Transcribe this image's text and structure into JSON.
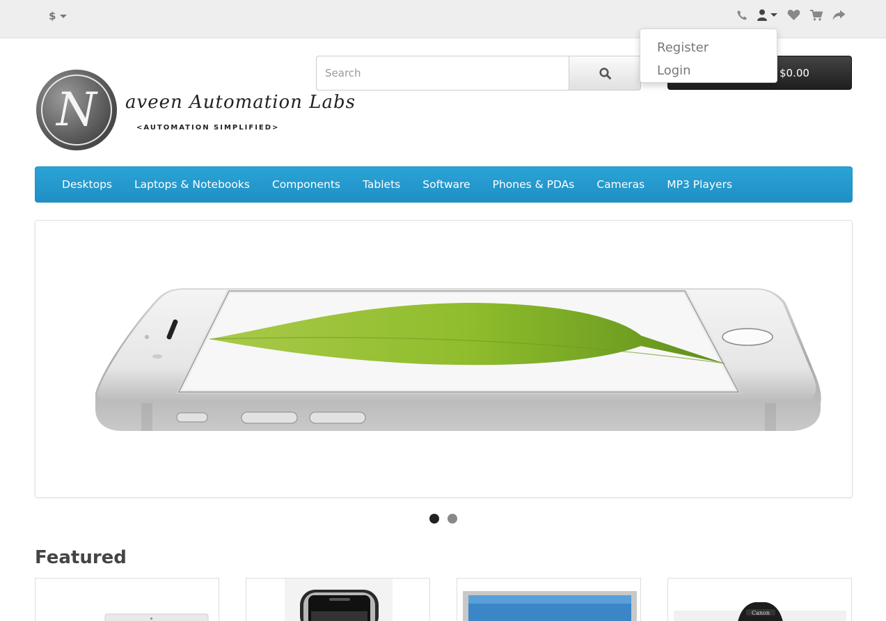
{
  "topbar": {
    "currency_symbol": "$",
    "icons": [
      "phone-icon",
      "user-icon",
      "heart-icon",
      "cart-icon",
      "share-icon"
    ]
  },
  "account_dropdown": {
    "items": [
      "Register",
      "Login"
    ]
  },
  "logo": {
    "letter": "N",
    "name": "aveen Automation Labs",
    "tagline": "<AUTOMATION SIMPLIFIED>"
  },
  "search": {
    "placeholder": "Search",
    "value": ""
  },
  "cart": {
    "total": "$0.00"
  },
  "nav": {
    "items": [
      "Desktops",
      "Laptops & Notebooks",
      "Components",
      "Tablets",
      "Software",
      "Phones & PDAs",
      "Cameras",
      "MP3 Players"
    ]
  },
  "slideshow": {
    "slide_count": 2,
    "active_index": 0
  },
  "featured": {
    "title": "Featured"
  },
  "colors": {
    "nav_bg": "#229ac8",
    "topbar_bg": "#eeeeee",
    "cart_bg": "#303030"
  }
}
